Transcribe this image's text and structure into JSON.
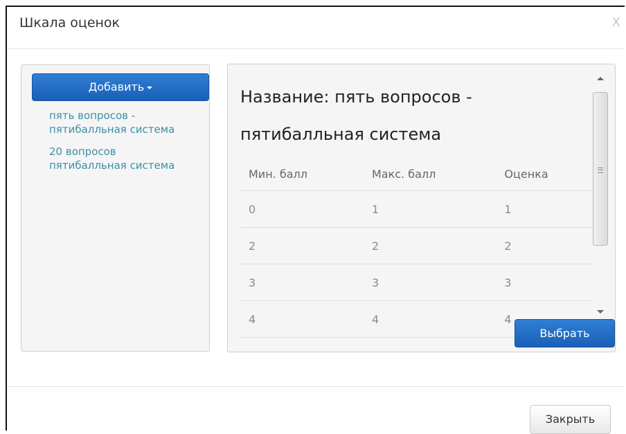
{
  "dialog": {
    "title": "Шкала оценок",
    "close_symbol": "X"
  },
  "sidebar": {
    "add_button_label": "Добавить",
    "items": [
      {
        "label": "пять вопросов - пятибалльная система"
      },
      {
        "label": "20 вопросов пятибалльная система"
      }
    ]
  },
  "detail": {
    "title": "Название: пять вопросов - пятибалльная система",
    "columns": [
      "Мин. балл",
      "Макс. балл",
      "Оценка"
    ],
    "rows": [
      [
        "0",
        "1",
        "1"
      ],
      [
        "2",
        "2",
        "2"
      ],
      [
        "3",
        "3",
        "3"
      ],
      [
        "4",
        "4",
        "4"
      ]
    ],
    "select_button_label": "Выбрать"
  },
  "footer": {
    "close_button_label": "Закрыть"
  }
}
